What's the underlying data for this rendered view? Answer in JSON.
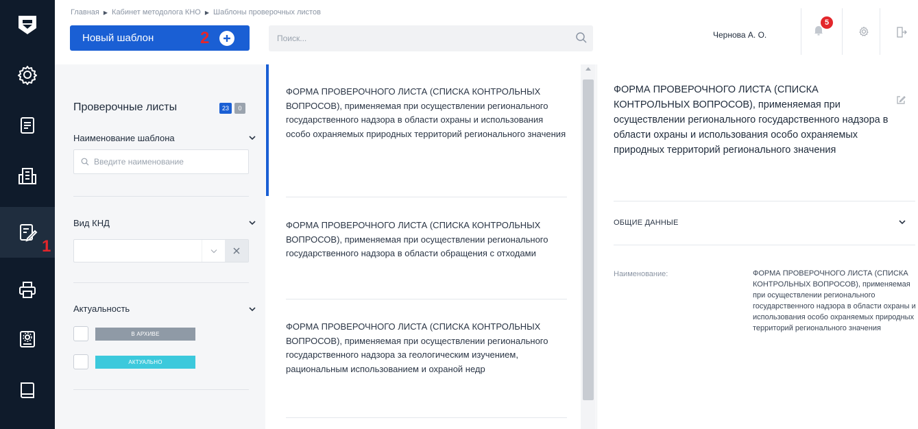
{
  "sidebar": {
    "items": [
      {
        "icon": "settings-icon"
      },
      {
        "icon": "document-list-icon"
      },
      {
        "icon": "building-icon"
      },
      {
        "icon": "checklist-edit-icon",
        "active": true,
        "annotation": "1"
      },
      {
        "icon": "printer-icon"
      },
      {
        "icon": "settings-book-icon"
      },
      {
        "icon": "book-icon"
      }
    ]
  },
  "header": {
    "breadcrumb": [
      "Главная",
      "Кабинет методолога КНО",
      "Шаблоны проверочных листов"
    ],
    "new_button_label": "Новый шаблон",
    "new_button_annotation": "2",
    "search_placeholder": "Поиск...",
    "user_name": "Чернова А. О.",
    "notification_count": "5"
  },
  "filters": {
    "title": "Проверочные листы",
    "count_total": "23",
    "count_other": "0",
    "template_name_label": "Наименование шаблона",
    "template_name_placeholder": "Введите наименование",
    "knd_label": "Вид КНД",
    "relevance_label": "Актуальность",
    "archive_tag": "В АРХИВЕ",
    "actual_tag": "АКТУАЛЬНО"
  },
  "list": {
    "items": [
      {
        "text": "ФОРМА ПРОВЕРОЧНОГО ЛИСТА (СПИСКА КОНТРОЛЬНЫХ ВОПРОСОВ), применяемая при осуществлении регионального государственного надзора в области охраны и использования особо охраняемых природных территорий регионального значения"
      },
      {
        "text": "ФОРМА ПРОВЕРОЧНОГО ЛИСТА (СПИСКА КОНТРОЛЬНЫХ ВОПРОСОВ), применяемая при осуществлении регионального государственного надзора в области обращения с отходами"
      },
      {
        "text": "ФОРМА ПРОВЕРОЧНОГО ЛИСТА (СПИСКА КОНТРОЛЬНЫХ ВОПРОСОВ), применяемая при осуществлении регионального государственного надзора за геологическим изучением, рациональным использованием и охраной недр"
      }
    ]
  },
  "details": {
    "title": "ФОРМА ПРОВЕРОЧНОГО ЛИСТА (СПИСКА КОНТРОЛЬНЫХ ВОПРОСОВ), применяемая при осуществлении регионального государственного надзора в области охраны и использования особо охраняемых природных территорий регионального значения",
    "section_label": "ОБЩИЕ ДАННЫЕ",
    "name_label": "Наименование:",
    "name_value": "ФОРМА ПРОВЕРОЧНОГО ЛИСТА (СПИСКА КОНТРОЛЬНЫХ ВОПРОСОВ), применяемая при осуществлении регионального государственного надзора в области охраны и использования особо охраняемых природных территорий регионального значения"
  },
  "colors": {
    "sidebar_bg": "#0f1b2b",
    "primary": "#1a5fd4",
    "annotation_red": "#e3262b",
    "archive_tag": "#8f9aa6",
    "actual_tag": "#3cc9dc"
  }
}
